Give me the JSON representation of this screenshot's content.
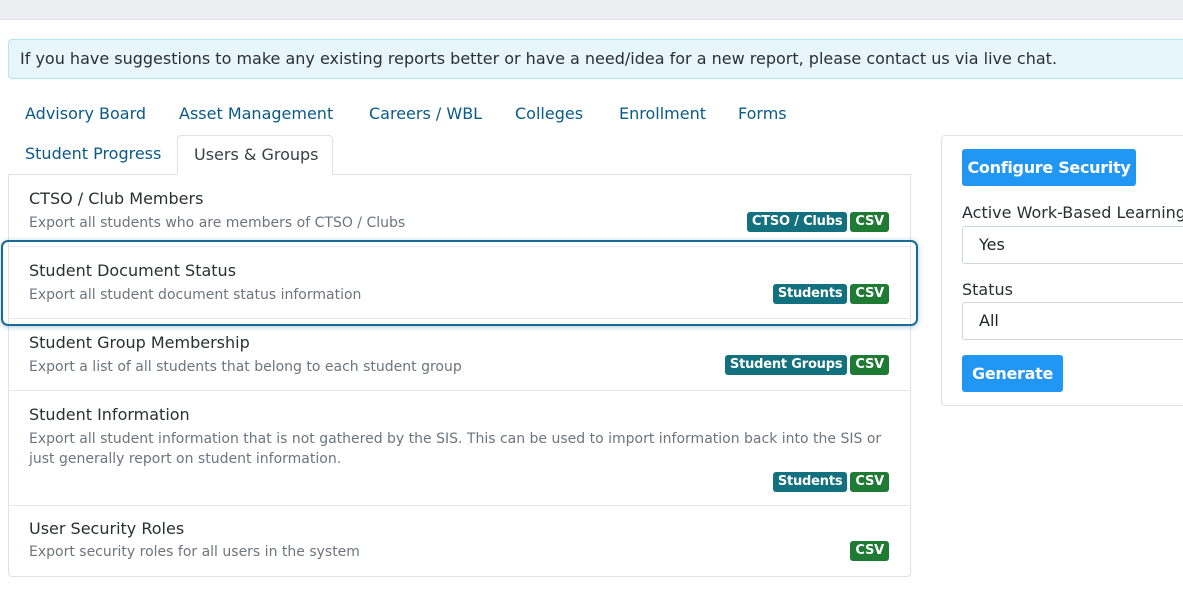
{
  "alert": {
    "text": "If you have suggestions to make any existing reports better or have a need/idea for a new report, please contact us via live chat."
  },
  "tabs": [
    {
      "label": "Advisory Board"
    },
    {
      "label": "Asset Management"
    },
    {
      "label": "Careers / WBL"
    },
    {
      "label": "Colleges"
    },
    {
      "label": "Enrollment"
    },
    {
      "label": "Forms"
    },
    {
      "label": "Student Progress"
    },
    {
      "label": "Users & Groups",
      "active": true
    }
  ],
  "reports": [
    {
      "title": "CTSO / Club Members",
      "description": "Export all students who are members of CTSO / Clubs",
      "badges": [
        "CTSO / Clubs",
        "CSV"
      ]
    },
    {
      "title": "Student Document Status",
      "description": "Export all student document status information",
      "badges": [
        "Students",
        "CSV"
      ],
      "selected": true
    },
    {
      "title": "Student Group Membership",
      "description": "Export a list of all students that belong to each student group",
      "badges": [
        "Student Groups",
        "CSV"
      ]
    },
    {
      "title": "Student Information",
      "description": "Export all student information that is not gathered by the SIS. This can be used to import information back into the SIS or just generally report on student information.",
      "badges": [
        "Students",
        "CSV"
      ]
    },
    {
      "title": "User Security Roles",
      "description": "Export security roles for all users in the system",
      "badges": [
        "CSV"
      ]
    }
  ],
  "panel": {
    "configure_label": "Configure Security",
    "filters": [
      {
        "label": "Active Work-Based Learning",
        "value": "Yes"
      },
      {
        "label": "Status",
        "value": "All"
      }
    ],
    "generate_label": "Generate"
  },
  "colors": {
    "tab_link": "#0a5a87",
    "badge_teal": "#13707e",
    "badge_green": "#1f7a34",
    "button_primary": "#2196f3",
    "selection_outline": "#1a6a96"
  }
}
